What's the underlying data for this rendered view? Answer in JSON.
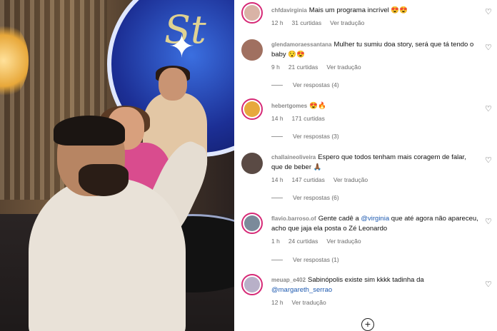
{
  "comments": [
    {
      "username": "chfdavirginia",
      "text": "Mais um programa incrível 😍😍",
      "time": "12 h",
      "likes": "31 curtidas",
      "translate": "Ver tradução"
    },
    {
      "username": "glendamoraessantana",
      "text": "Mulher tu sumiu doa story, será que tá tendo o baby 😯😍",
      "time": "9 h",
      "likes": "21 curtidas",
      "translate": "Ver tradução",
      "replies": "Ver respostas (4)"
    },
    {
      "username": "hebertgomes",
      "text": "😍🔥",
      "time": "14 h",
      "likes": "171 curtidas",
      "replies": "Ver respostas (3)"
    },
    {
      "username": "challaineoliveira",
      "text": "Espero que todos tenham mais coragem de falar, que de beber 🙏🏾",
      "time": "14 h",
      "likes": "147 curtidas",
      "translate": "Ver tradução",
      "replies": "Ver respostas (6)"
    },
    {
      "username": "flavio.barroso.of",
      "text_before": "Gente cadê a ",
      "mention": "@virginia",
      "text_after": " que até agora não apareceu, acho que jaja ela posta o Zé Leonardo",
      "time": "1 h",
      "likes": "24 curtidas",
      "translate": "Ver tradução",
      "replies": "Ver respostas (1)"
    },
    {
      "username": "meuap_e402",
      "text": "Sabinópolis existe sim kkkk tadinha da",
      "mention": "@margareth_serrao",
      "time": "12 h",
      "translate": "Ver tradução"
    }
  ],
  "video": {
    "screen_text": "St"
  },
  "colors": {
    "story_ring": "#d62976",
    "mention": "#1e5ab0"
  },
  "icons": {
    "like": "heart-icon",
    "add": "plus-circle-icon"
  }
}
